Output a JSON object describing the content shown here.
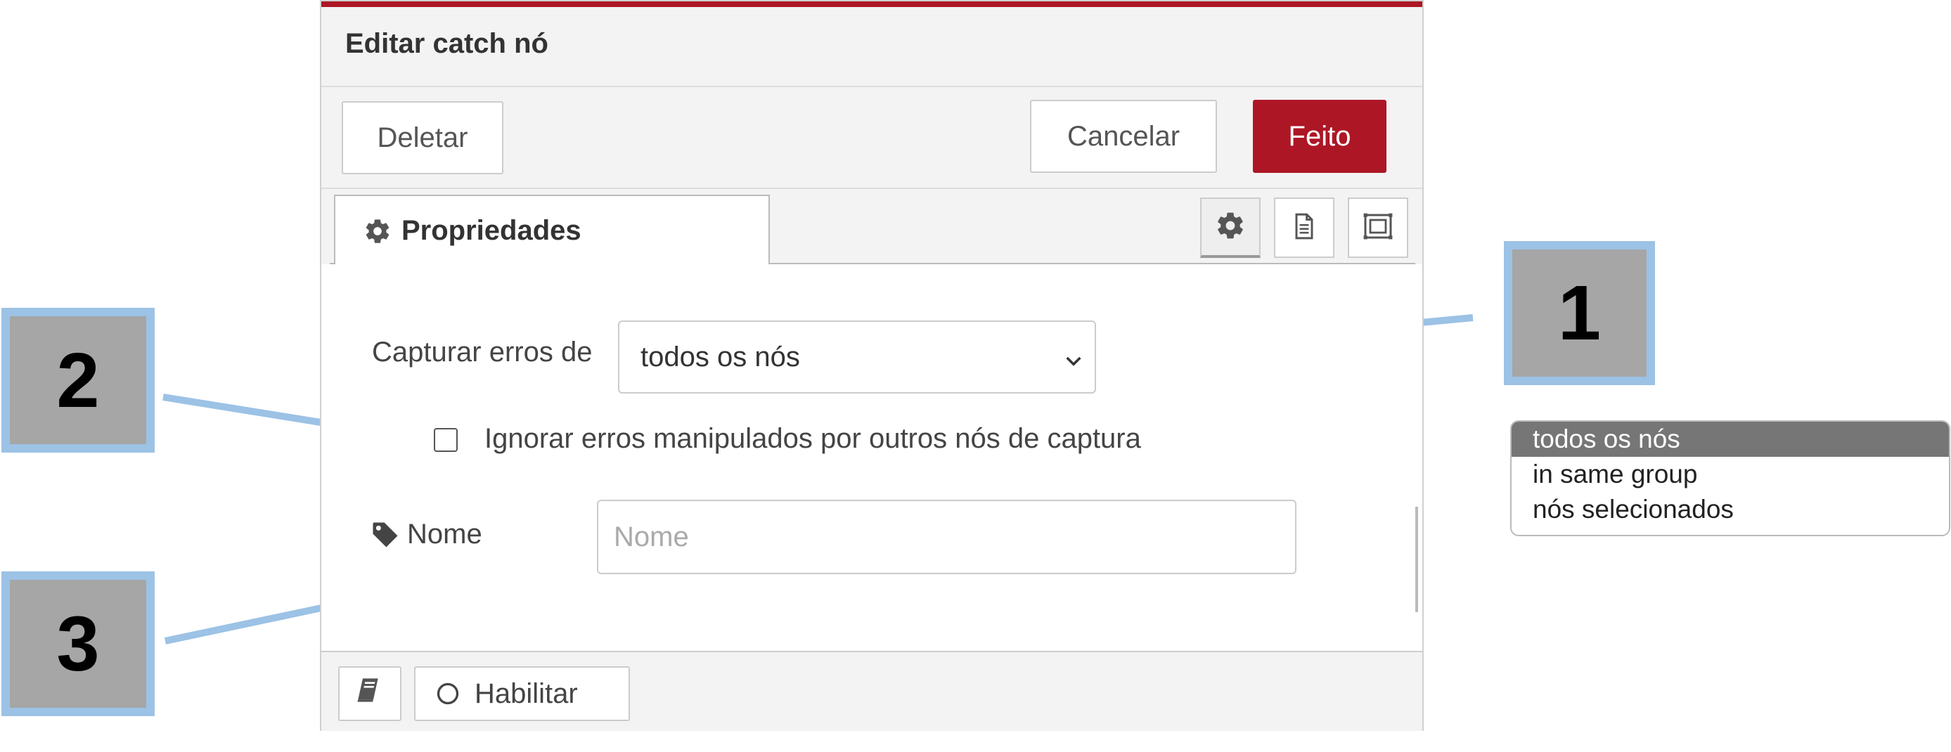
{
  "dialog": {
    "title": "Editar catch nó",
    "buttons": {
      "delete": "Deletar",
      "cancel": "Cancelar",
      "done": "Feito"
    },
    "tab_label": "Propriedades",
    "icons": [
      "gear-icon",
      "document-icon",
      "frame-icon"
    ]
  },
  "form": {
    "scope_label": "Capturar erros de",
    "scope_value": "todos os nós",
    "uncaught_label": "Ignorar erros manipulados por outros nós de captura",
    "uncaught_checked": false,
    "name_label": "Nome",
    "name_placeholder": "Nome",
    "name_value": ""
  },
  "footer": {
    "book_icon": "book-icon",
    "enable_label": "Habilitar"
  },
  "callouts": [
    "1",
    "2",
    "3"
  ],
  "dropdown": {
    "options": [
      "todos os nós",
      "in same group",
      "nós selecionados"
    ],
    "selected_index": 0
  },
  "colors": {
    "accent": "#ad1625",
    "callout_fill": "#a6a6a6",
    "callout_border": "#9cc2e5",
    "dropdown_selected": "#767676"
  }
}
